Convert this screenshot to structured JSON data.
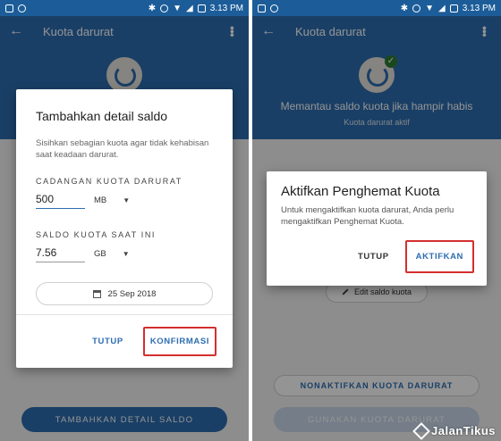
{
  "status_bar": {
    "time": "3.13 PM"
  },
  "left_screen": {
    "app_title": "Kuota darurat",
    "dialog": {
      "title": "Tambahkan detail saldo",
      "description": "Sisihkan sebagian kuota agar tidak kehabisan saat keadaan darurat.",
      "reserve_label": "CADANGAN KUOTA DARURAT",
      "reserve_value": "500",
      "reserve_unit": "MB",
      "balance_label": "SALDO KUOTA SAAT INI",
      "balance_value": "7.56",
      "balance_unit": "GB",
      "date": "25 Sep 2018",
      "cancel_label": "TUTUP",
      "confirm_label": "KONFIRMASI"
    },
    "bottom_button": "TAMBAHKAN DETAIL SALDO"
  },
  "right_screen": {
    "app_title": "Kuota darurat",
    "headline": "Memantau saldo kuota jika hampir habis",
    "subheadline": "Kuota darurat aktif",
    "dialog": {
      "title": "Aktifkan Penghemat Kuota",
      "description": "Untuk mengaktifkan kuota darurat, Anda perlu mengaktifkan Penghemat Kuota.",
      "cancel_label": "TUTUP",
      "confirm_label": "AKTIFKAN"
    },
    "edit_button": "Edit saldo kuota",
    "deactivate_button": "NONAKTIFKAN KUOTA DARURAT",
    "use_button": "GUNAKAN KUOTA DARURAT"
  },
  "watermark": "JalanTikus",
  "colors": {
    "primary": "#2d6db0",
    "statusbar": "#1c5d99",
    "highlight": "#d32f2f"
  }
}
